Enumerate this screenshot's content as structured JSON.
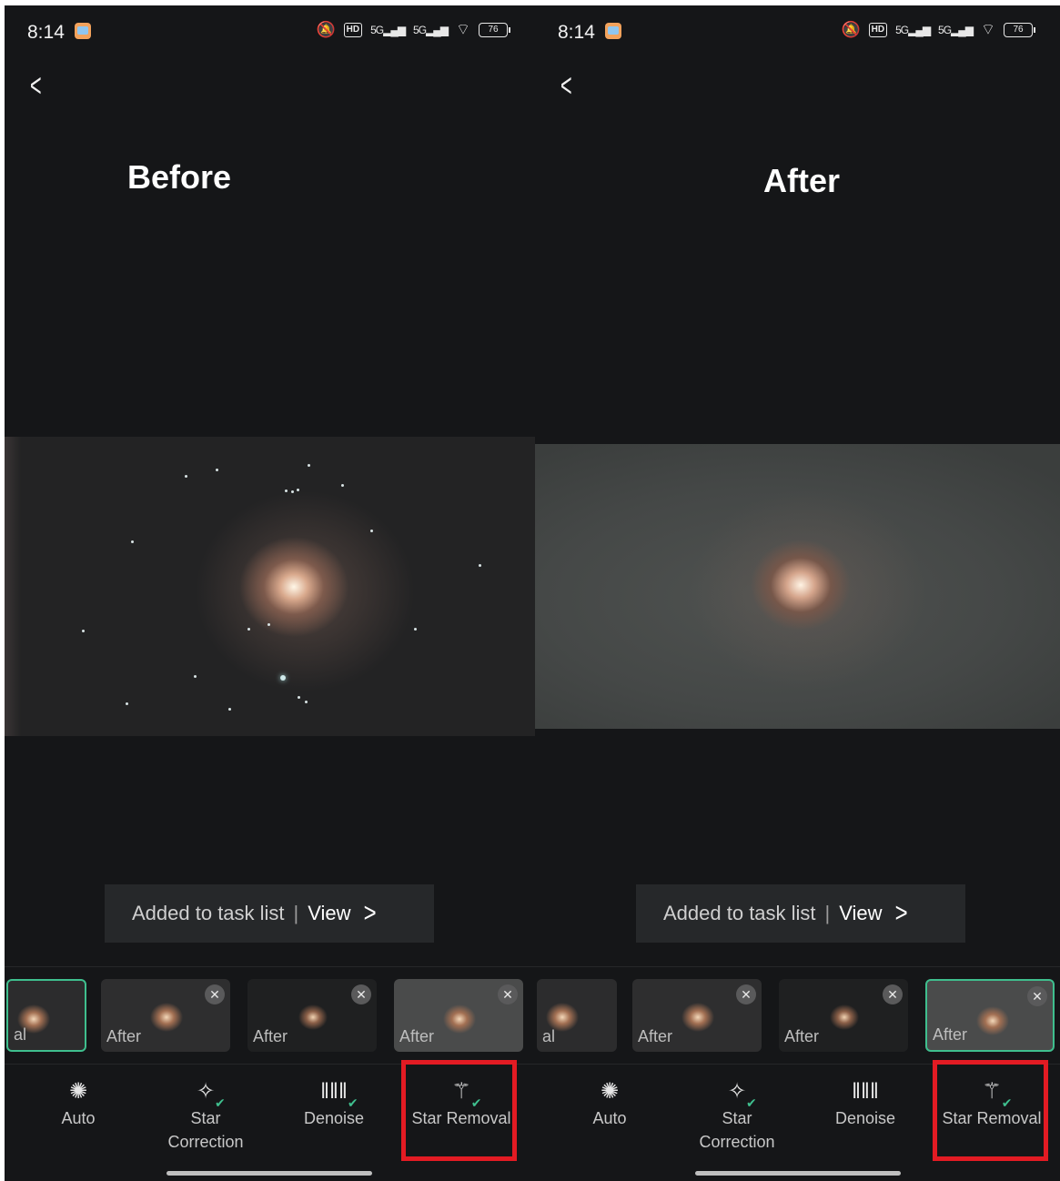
{
  "screens": [
    {
      "time": "8:14",
      "battery": "76",
      "compare_label": "Before",
      "toast": {
        "text": "Added to task list",
        "separator": "|",
        "view": "View"
      },
      "thumbnails": [
        "al",
        "After",
        "After",
        "After"
      ],
      "tools": [
        {
          "label": "Auto",
          "icon": "aperture-icon"
        },
        {
          "label": "Star Correction",
          "icon": "sparkle-icon"
        },
        {
          "label": "Denoise",
          "icon": "waveform-icon"
        },
        {
          "label": "Star Removal",
          "icon": "magic-wand-icon"
        }
      ]
    },
    {
      "time": "8:14",
      "battery": "76",
      "compare_label": "After",
      "toast": {
        "text": "Added to task list",
        "separator": "|",
        "view": "View"
      },
      "thumbnails": [
        "al",
        "After",
        "After",
        "After"
      ],
      "tools": [
        {
          "label": "Auto",
          "icon": "aperture-icon"
        },
        {
          "label": "Star Correction",
          "icon": "sparkle-icon"
        },
        {
          "label": "Denoise",
          "icon": "waveform-icon"
        },
        {
          "label": "Star Removal",
          "icon": "magic-wand-icon"
        }
      ]
    }
  ],
  "colors": {
    "highlight": "#e31b23",
    "check": "#3fbf8e",
    "background": "#151618"
  }
}
